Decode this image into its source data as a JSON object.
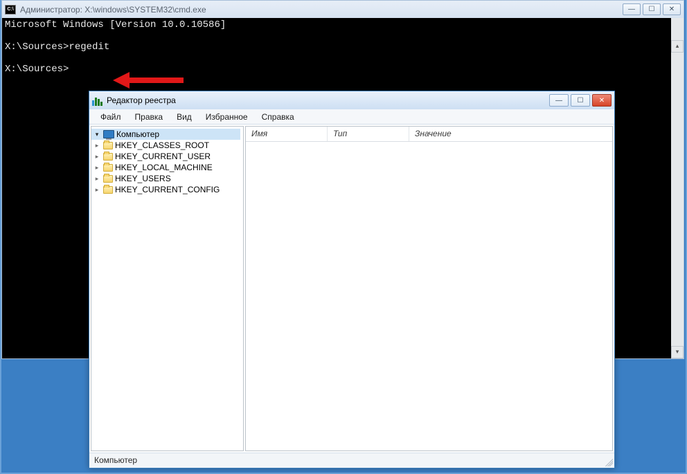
{
  "cmd": {
    "title": "Администратор: X:\\windows\\SYSTEM32\\cmd.exe",
    "line1": "Microsoft Windows [Version 10.0.10586]",
    "prompt1": "X:\\Sources>",
    "command": "regedit",
    "prompt2": "X:\\Sources>"
  },
  "regedit": {
    "title": "Редактор реестра",
    "menu": {
      "file": "Файл",
      "edit": "Правка",
      "view": "Вид",
      "favorites": "Избранное",
      "help": "Справка"
    },
    "tree": {
      "root": "Компьютер",
      "items": [
        "HKEY_CLASSES_ROOT",
        "HKEY_CURRENT_USER",
        "HKEY_LOCAL_MACHINE",
        "HKEY_USERS",
        "HKEY_CURRENT_CONFIG"
      ]
    },
    "columns": {
      "name": "Имя",
      "type": "Тип",
      "value": "Значение"
    },
    "status": "Компьютер"
  }
}
